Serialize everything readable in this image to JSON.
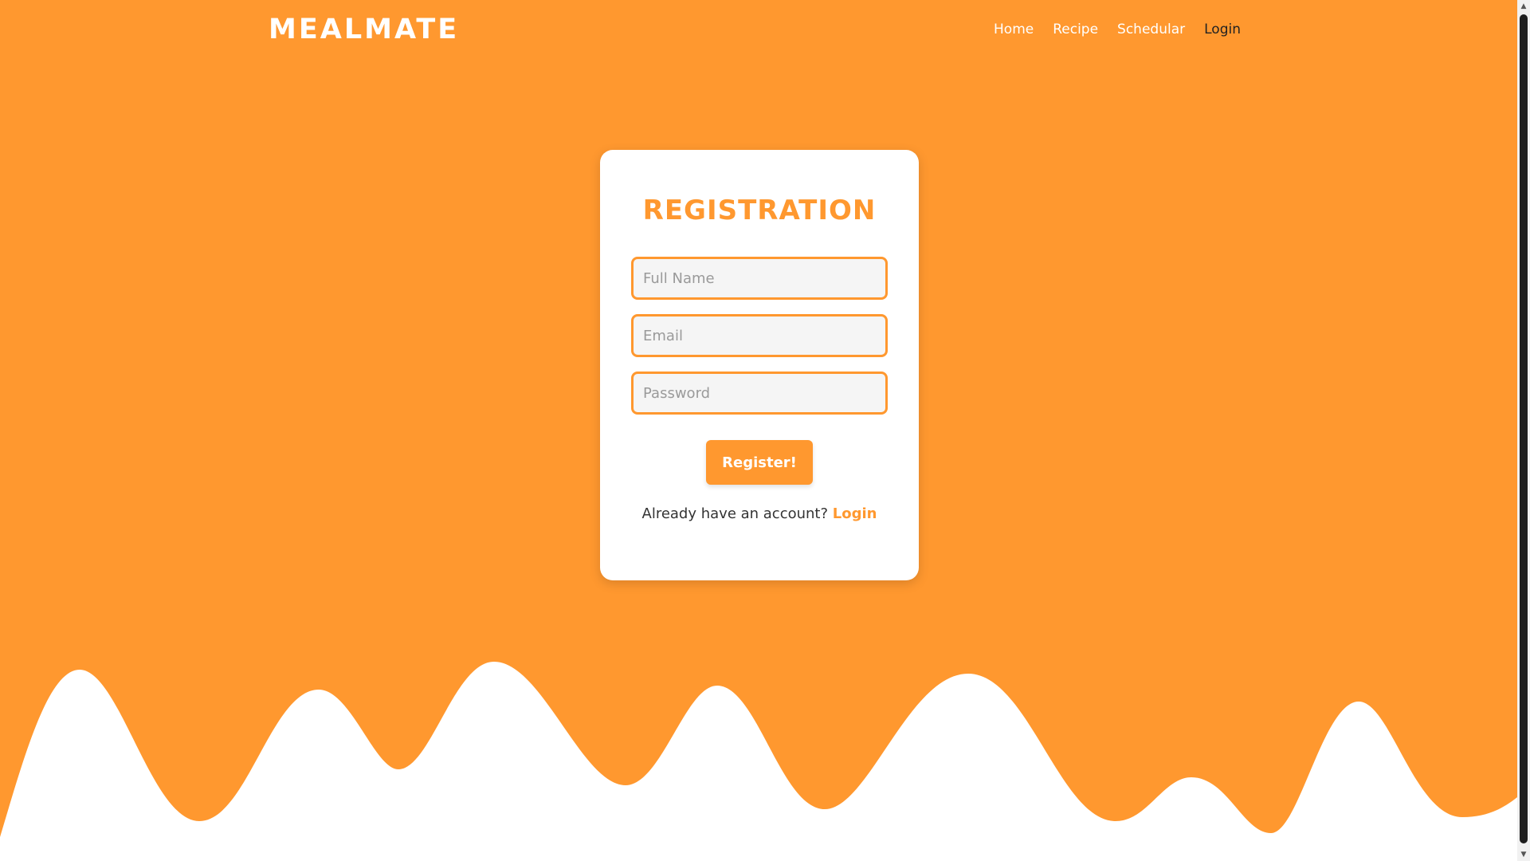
{
  "brand": {
    "logo": "MEALMATE",
    "primary_color": "#ff982f",
    "text_color": "#333333"
  },
  "nav": {
    "items": [
      {
        "label": "Home"
      },
      {
        "label": "Recipe"
      },
      {
        "label": "Schedular"
      },
      {
        "label": "Login"
      }
    ]
  },
  "registration": {
    "title": "REGISTRATION",
    "fields": {
      "full_name_placeholder": "Full Name",
      "email_placeholder": "Email",
      "password_placeholder": "Password"
    },
    "submit_label": "Register!",
    "footer_text": "Already have an account?",
    "footer_link": "Login"
  },
  "scrollbar": {
    "up_icon": "chevron-up-icon",
    "down_icon": "chevron-down-icon"
  }
}
